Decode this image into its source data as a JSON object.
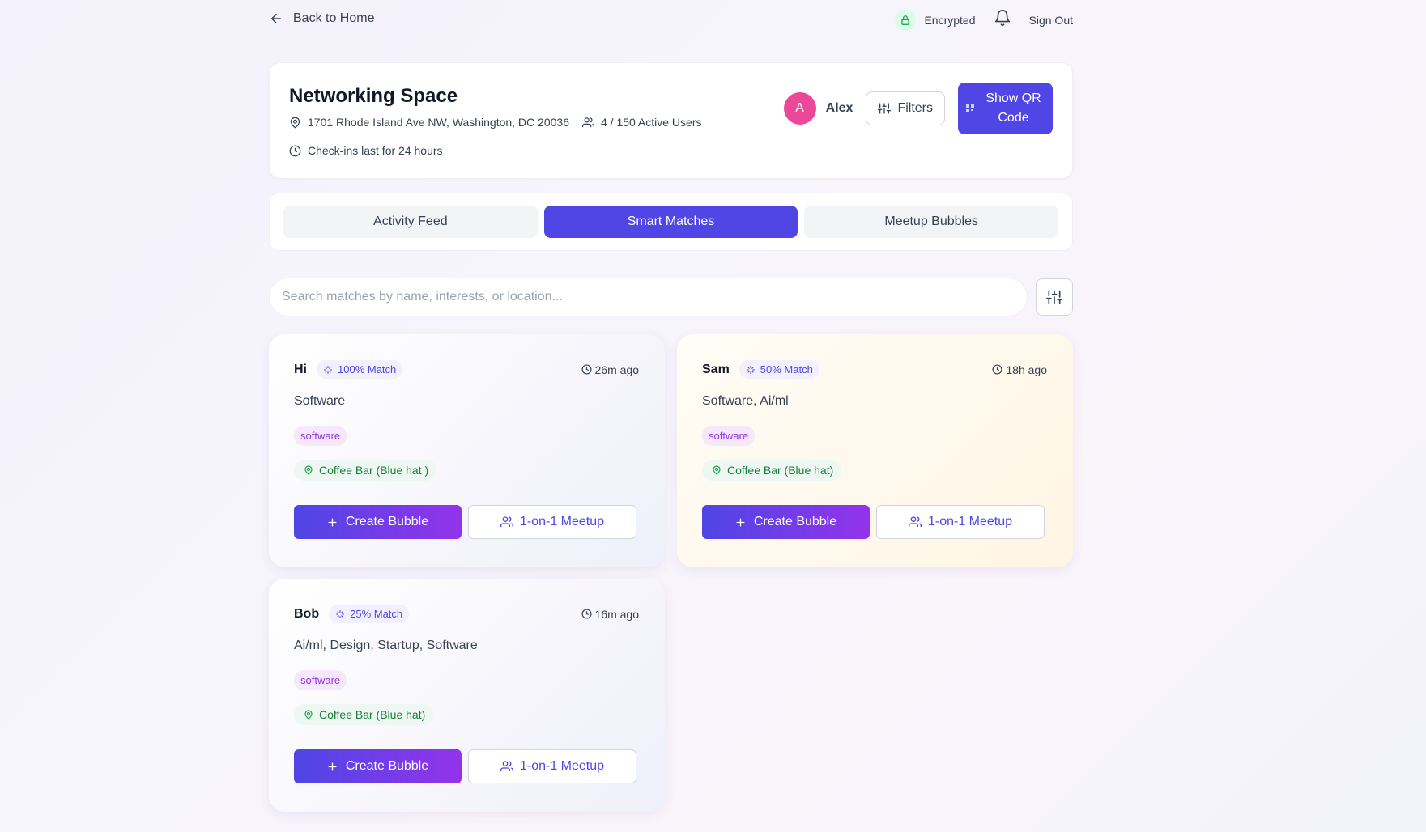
{
  "nav": {
    "back_label": "Back to Home",
    "encrypted_label": "Encrypted",
    "signout_label": "Sign Out"
  },
  "space": {
    "title": "Networking Space",
    "address": "1701 Rhode Island Ave NW, Washington, DC 20036",
    "active_users": "4 / 150 Active Users",
    "checkin_note": "Check-ins last for 24 hours"
  },
  "user": {
    "initial": "A",
    "name": "Alex"
  },
  "actions": {
    "filters_label": "Filters",
    "qr_label": "Show QR Code"
  },
  "tabs": [
    {
      "label": "Activity Feed",
      "active": false
    },
    {
      "label": "Smart Matches",
      "active": true
    },
    {
      "label": "Meetup Bubbles",
      "active": false
    }
  ],
  "search": {
    "placeholder": "Search matches by name, interests, or location...",
    "value": ""
  },
  "matches": [
    {
      "name": "Hi",
      "match": "100% Match",
      "time": "26m ago",
      "interests": "Software",
      "tag": "software",
      "location": "Coffee Bar (Blue hat )",
      "create_label": "Create Bubble",
      "meetup_label": "1-on-1 Meetup"
    },
    {
      "name": "Sam",
      "match": "50% Match",
      "time": "18h ago",
      "interests": "Software, Ai/ml",
      "tag": "software",
      "location": "Coffee Bar (Blue hat)",
      "create_label": "Create Bubble",
      "meetup_label": "1-on-1 Meetup"
    },
    {
      "name": "Bob",
      "match": "25% Match",
      "time": "16m ago",
      "interests": "Ai/ml, Design, Startup, Software",
      "tag": "software",
      "location": "Coffee Bar (Blue hat)",
      "create_label": "Create Bubble",
      "meetup_label": "1-on-1 Meetup"
    }
  ],
  "colors": {
    "primary": "#4f46e5",
    "avatar": "#ec4899",
    "tag_text": "#9333ea",
    "location_text": "#15803d"
  },
  "icons": [
    "arrow-left-icon",
    "lock-icon",
    "bell-icon",
    "map-pin-icon",
    "users-icon",
    "clock-icon",
    "sliders-icon",
    "qr-icon",
    "sparkles-icon",
    "plus-icon"
  ]
}
